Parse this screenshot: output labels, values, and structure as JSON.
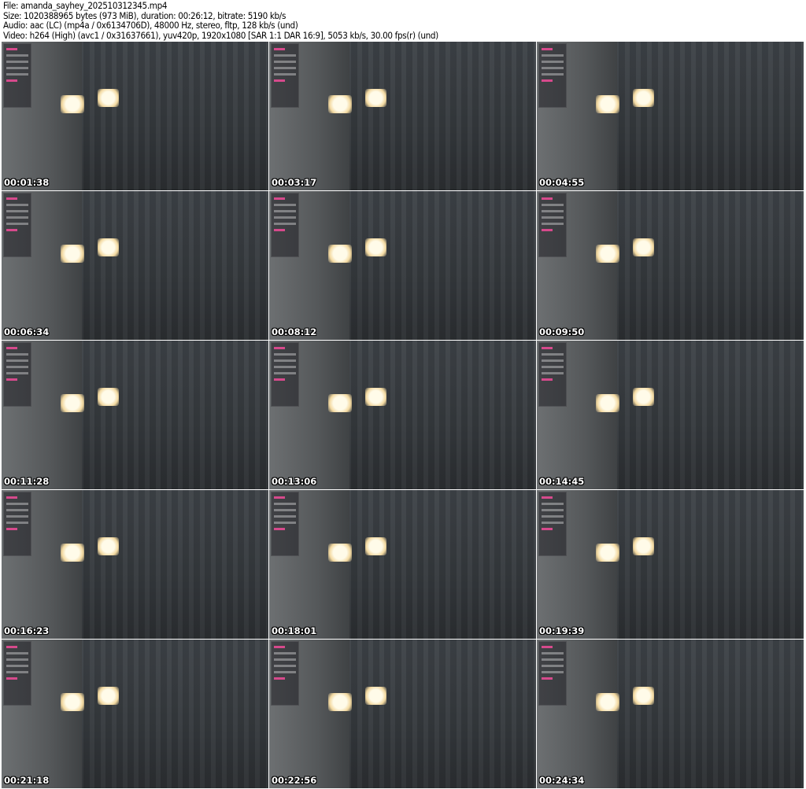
{
  "header": {
    "file": "File: amanda_sayhey_202510312345.mp4",
    "size": "Size: 1020388965 bytes (973 MiB), duration: 00:26:12, bitrate: 5190 kb/s",
    "audio": "Audio: aac (LC) (mp4a / 0x6134706D), 48000 Hz, stereo, fltp, 128 kb/s (und)",
    "video": "Video: h264 (High) (avc1 / 0x31637661), yuv420p, 1920x1080 [SAR 1:1 DAR 16:9], 5053 kb/s, 30.00 fps(r) (und)"
  },
  "thumbnails": [
    {
      "timestamp": "00:01:38"
    },
    {
      "timestamp": "00:03:17"
    },
    {
      "timestamp": "00:04:55"
    },
    {
      "timestamp": "00:06:34"
    },
    {
      "timestamp": "00:08:12"
    },
    {
      "timestamp": "00:09:50"
    },
    {
      "timestamp": "00:11:28"
    },
    {
      "timestamp": "00:13:06"
    },
    {
      "timestamp": "00:14:45"
    },
    {
      "timestamp": "00:16:23"
    },
    {
      "timestamp": "00:18:01"
    },
    {
      "timestamp": "00:19:39"
    },
    {
      "timestamp": "00:21:18"
    },
    {
      "timestamp": "00:22:56"
    },
    {
      "timestamp": "00:24:34"
    }
  ]
}
